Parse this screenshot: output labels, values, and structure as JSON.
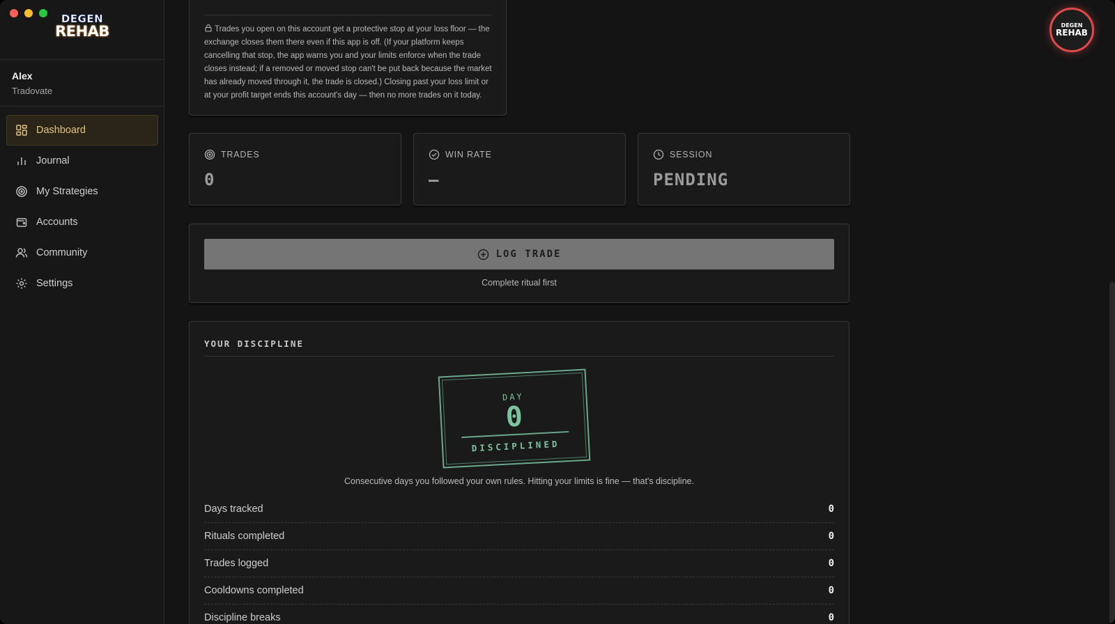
{
  "app": {
    "logo_line1": "DEGEN",
    "logo_line2": "REHAB"
  },
  "user": {
    "name": "Alex",
    "platform": "Tradovate"
  },
  "sidebar": {
    "items": [
      {
        "label": "Dashboard",
        "icon": "dashboard-icon",
        "active": true
      },
      {
        "label": "Journal",
        "icon": "bar-chart-icon"
      },
      {
        "label": "My Strategies",
        "icon": "target-icon"
      },
      {
        "label": "Accounts",
        "icon": "wallet-icon"
      },
      {
        "label": "Community",
        "icon": "users-icon"
      },
      {
        "label": "Settings",
        "icon": "gear-icon"
      }
    ]
  },
  "info": {
    "text": "Trades you open on this account get a protective stop at your loss floor — the exchange closes them there even if this app is off. (If your platform keeps cancelling that stop, the app warns you and your limits enforce when the trade closes instead; if a removed or moved stop can't be put back because the market has already moved through it, the trade is closed.) Closing past your loss limit or at your profit target ends this account's day — then no more trades on it today."
  },
  "stats": [
    {
      "label": "TRADES",
      "value": "0",
      "icon": "target-icon"
    },
    {
      "label": "WIN RATE",
      "value": "—",
      "icon": "check-circle-icon"
    },
    {
      "label": "SESSION",
      "value": "PENDING",
      "icon": "clock-icon"
    }
  ],
  "log": {
    "button_label": "LOG TRADE",
    "hint": "Complete ritual first"
  },
  "discipline": {
    "title": "YOUR DISCIPLINE",
    "stamp_day_label": "DAY",
    "stamp_day_value": "0",
    "stamp_word": "DISCIPLINED",
    "caption": "Consecutive days you followed your own rules. Hitting your limits is fine — that's discipline.",
    "metrics": [
      {
        "label": "Days tracked",
        "value": "0"
      },
      {
        "label": "Rituals completed",
        "value": "0"
      },
      {
        "label": "Trades logged",
        "value": "0"
      },
      {
        "label": "Cooldowns completed",
        "value": "0"
      },
      {
        "label": "Discipline breaks",
        "value": "0"
      }
    ]
  },
  "avatar": {
    "line1": "DEGEN",
    "line2": "REHAB"
  },
  "colors": {
    "accent": "#e2c47f",
    "stamp": "#7cc39f",
    "avatar_ring": "#e04a4a"
  }
}
